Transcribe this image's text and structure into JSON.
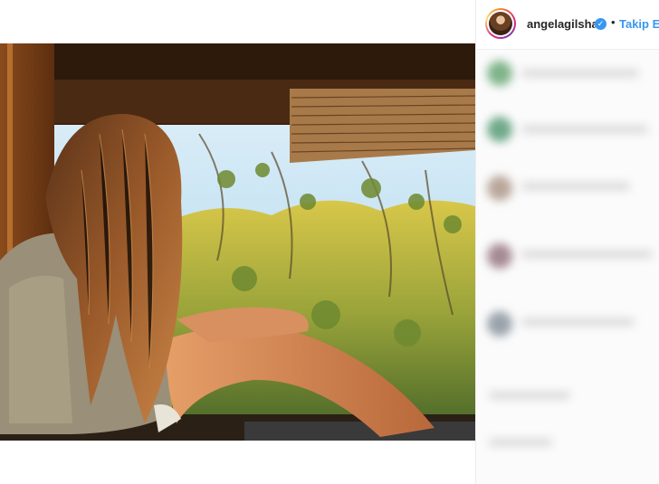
{
  "post": {
    "photo": {
      "icon": "photo-girl-sitting-by-window"
    }
  },
  "header": {
    "username": "angelagilsha",
    "verified_icon": "verified-badge-icon",
    "separator": "•",
    "follow_label": "Takip Et"
  },
  "comments": {
    "state": "blurred",
    "items": [
      "",
      "",
      "",
      "",
      "",
      ""
    ]
  },
  "colors": {
    "follow": "#3897f0",
    "verified": "#3897f0",
    "text": "#262626"
  }
}
